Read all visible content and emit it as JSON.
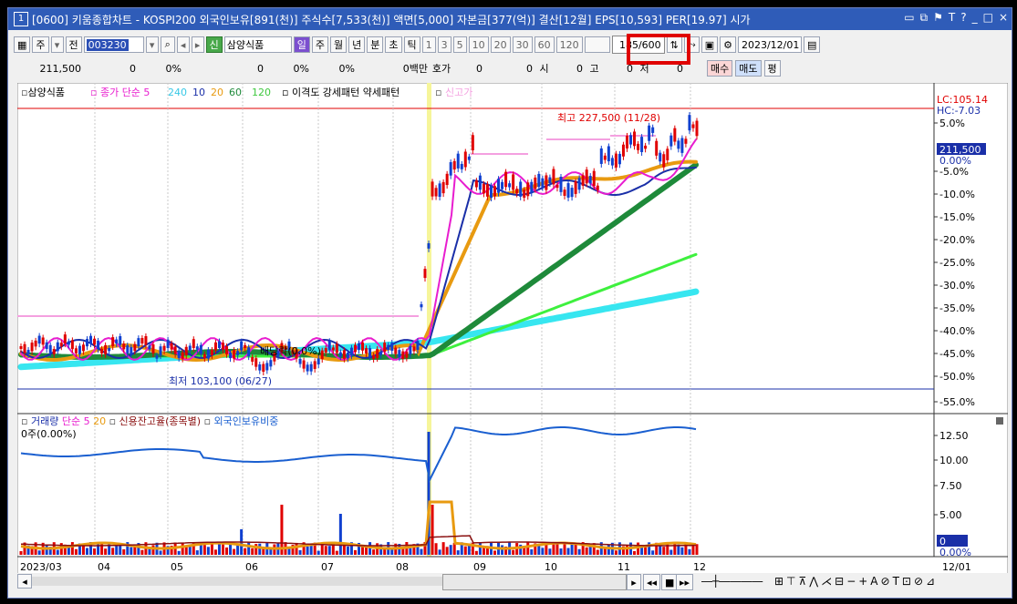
{
  "title": {
    "number": "1",
    "text": "[0600] 키움종합차트 - KOSPI200 외국인보유[891(천)] 주식수[7,533(천)] 액면[5,000] 자본금[377(억)] 결산[12월] EPS[10,593] PER[19.97] 시가"
  },
  "toolbar": {
    "jong": "주",
    "jeon": "전",
    "code": "003230",
    "sin": "신",
    "stock_name": "삼양식품",
    "periods": [
      "일",
      "주",
      "월",
      "년",
      "분",
      "초",
      "틱"
    ],
    "active_period": "일",
    "intervals": [
      "1",
      "3",
      "5",
      "10",
      "20",
      "30",
      "60",
      "120"
    ],
    "count": "185",
    "count_max": "/600",
    "date": "2023/12/01"
  },
  "quote": {
    "price": "211,500",
    "change": "0",
    "change_pct": "0%",
    "v1": "0",
    "v1_pct": "0%",
    "v2_pct": "0%",
    "amount": "0백만",
    "hoga_label": "호가",
    "hoga": "0",
    "v3": "0",
    "si_label": "시",
    "si": "0",
    "go_label": "고",
    "go": "0",
    "jeo_label": "저",
    "jeo": "0",
    "buy": "매수",
    "sell": "매도",
    "pyeong": "평"
  },
  "price_panel": {
    "legend_stock": "삼양식품",
    "legend_ma_label": "종가 단순 5",
    "legend_ma_values": [
      "240",
      "10",
      "20",
      "60",
      "120"
    ],
    "legend_rest": "이격도 강세패턴  약세패턴",
    "legend_new": "신고가",
    "high_label": "최고 227,500 (11/28)",
    "low_label": "최저 103,100 (06/27)",
    "dividend_label": "배당락(0.0%)",
    "lc": "LC:105.14",
    "hc": "HC:-7.03",
    "current_tag": "211,500",
    "current_pct": "0.00%",
    "pct_axis": [
      "5.0%",
      "-5.0%",
      "-10.0%",
      "-15.0%",
      "-20.0%",
      "-25.0%",
      "-30.0%",
      "-35.0%",
      "-40.0%",
      "-45.0%",
      "-50.0%",
      "-55.0%"
    ]
  },
  "volume_panel": {
    "legend_volume": "거래량",
    "legend_ma": "단순 5",
    "legend_ma2": "20",
    "legend_credit": "신용잔고율(종목별)",
    "legend_foreign": "외국인보유비중",
    "info": "0주(0.00%)",
    "axis": [
      "12.50",
      "10.00",
      "7.50",
      "5.00"
    ],
    "current_tag": "0",
    "current_pct": "0.00%"
  },
  "x_axis": [
    "2023/03",
    "04",
    "05",
    "06",
    "07",
    "08",
    "09",
    "10",
    "11",
    "12"
  ],
  "x_axis_right": "12/01",
  "colors": {
    "ma5": "#e81ccf",
    "ma10": "#1a2fa8",
    "ma20": "#e89a10",
    "ma60": "#1e8a3a",
    "ma120": "#3ef03e",
    "ma240": "#37e6f0",
    "up": "#e00000",
    "down": "#1040d0",
    "highlight": "#f6f59a"
  }
}
